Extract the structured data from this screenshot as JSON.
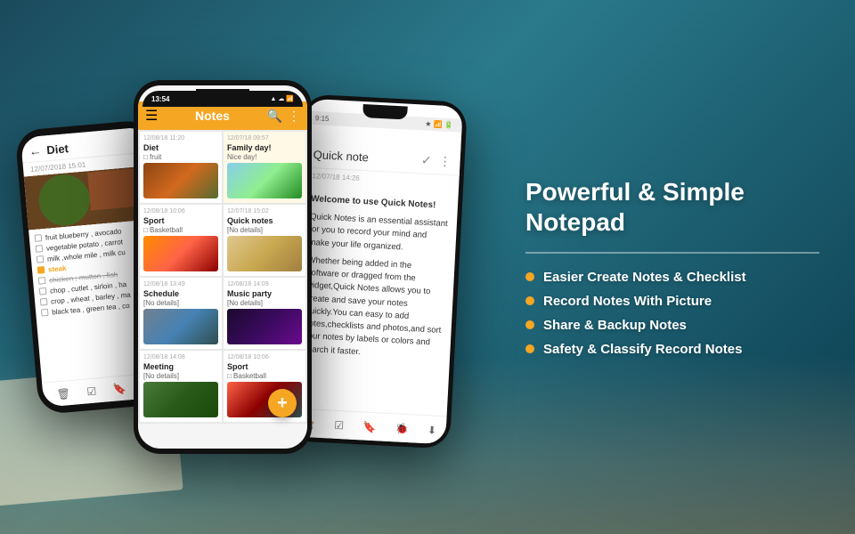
{
  "background": {
    "gradient": "linear-gradient(135deg, #1a4a5c 0%, #2a7a8c 40%, #1a5a6c 70%, #0a3a4c 100%)"
  },
  "rightPanel": {
    "title": "Powerful & Simple Notepad",
    "divider": true,
    "features": [
      "Easier Create Notes & Checklist",
      "Record Notes With Picture",
      "Share & Backup Notes",
      "Safety & Classify Record Notes"
    ]
  },
  "phoneLeft": {
    "header": {
      "backLabel": "←",
      "title": "Diet"
    },
    "date": "12/07/2018 15:01",
    "checklistItems": [
      {
        "text": "fruit blueberry , avocado",
        "checked": false,
        "strikethrough": false
      },
      {
        "text": "vegetable potato , carrot",
        "checked": false,
        "strikethrough": false
      },
      {
        "text": "milk ,whole mile , milk cu",
        "checked": false,
        "strikethrough": false
      },
      {
        "text": "steak",
        "checked": true,
        "strikethrough": false
      },
      {
        "text": "chicken , mutton , fish",
        "checked": false,
        "strikethrough": true
      },
      {
        "text": "chop , cutlet , sirloin , ha",
        "checked": false,
        "strikethrough": false
      },
      {
        "text": "crop , wheat , barley , ma",
        "checked": false,
        "strikethrough": false
      },
      {
        "text": "black tea , green tea , co",
        "checked": false,
        "strikethrough": false
      }
    ],
    "footerIcons": [
      "🗑",
      "☑",
      "🔖",
      "🐞"
    ]
  },
  "phoneMiddle": {
    "statusBar": {
      "time": "13:54",
      "icons": "▲ ☁ 📶"
    },
    "toolbar": {
      "menuIcon": "☰",
      "title": "Notes",
      "searchIcon": "🔍",
      "moreIcon": "⋮"
    },
    "noteCards": [
      {
        "date": "12/08/18 11:20",
        "title": "Diet",
        "text": "□ fruit",
        "hasImage": true,
        "imgClass": "img-food",
        "yellowBg": false
      },
      {
        "date": "12/07/18 09:57",
        "title": "Family day!",
        "text": "Nice day!",
        "hasImage": true,
        "imgClass": "img-family",
        "yellowBg": true
      },
      {
        "date": "12/08/18 10:06",
        "title": "Sport",
        "text": "□ Basketball",
        "hasImage": true,
        "imgClass": "img-sport",
        "yellowBg": false
      },
      {
        "date": "12/07/18 15:02",
        "title": "Quick notes",
        "text": "[No details]",
        "hasImage": true,
        "imgClass": "img-quicknote",
        "yellowBg": false
      },
      {
        "date": "12/08/18 13:49",
        "title": "Schedule",
        "text": "[No details]",
        "hasImage": true,
        "imgClass": "img-schedule",
        "yellowBg": false
      },
      {
        "date": "12/08/18 14:09",
        "title": "Music party",
        "text": "[No details]",
        "hasImage": true,
        "imgClass": "img-musicparty",
        "yellowBg": false
      },
      {
        "date": "12/08/18 14:08",
        "title": "Meeting",
        "text": "[No details]",
        "hasImage": true,
        "imgClass": "img-meeting",
        "yellowBg": false
      },
      {
        "date": "12/08/18 10:06",
        "title": "Sport",
        "text": "□ Basketball",
        "hasImage": true,
        "imgClass": "img-sport2",
        "yellowBg": false
      }
    ],
    "fab": "+"
  },
  "phoneRight": {
    "statusBar": {
      "time": "9:15",
      "icons": "★ 📶 🔋"
    },
    "header": {
      "title": "Quick note",
      "checkIcon": "✓",
      "moreIcon": "⋮"
    },
    "noteDate": "12/07/18 14:26",
    "content": [
      "Welcome to use Quick Notes!",
      "",
      "Quick Notes is an essential assistant for you to record your mind and make your life organized.",
      "",
      "Whether being added in the software or dragged from the widget,Quick Notes allows you to create and save your notes quickly.You can easy to add notes,checklists and photos,and sort your notes by labels or colors and search it faster."
    ],
    "footerIcons": [
      "🏠",
      "☑",
      "🔖",
      "🐞",
      "⬇"
    ]
  }
}
